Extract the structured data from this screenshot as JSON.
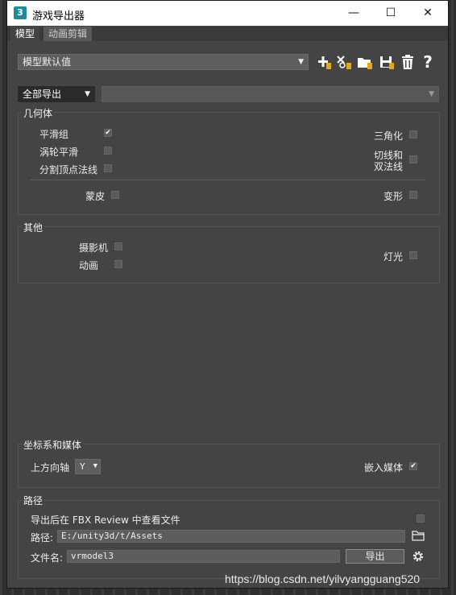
{
  "window": {
    "title": "游戏导出器",
    "app_icon_text": "3",
    "minimize_glyph": "—",
    "maximize_glyph": "☐",
    "close_glyph": "✕"
  },
  "tabs": [
    {
      "label": "模型",
      "active": true
    },
    {
      "label": "动画剪辑",
      "active": false
    }
  ],
  "preset": {
    "selected": "模型默认值"
  },
  "toolbar": {
    "icons": [
      "add-preset-icon",
      "save-as-preset-icon",
      "open-folder-icon",
      "save-icon",
      "trash-icon",
      "help-icon"
    ]
  },
  "export_mode": {
    "selected": "全部导出",
    "secondary_value": ""
  },
  "geometry": {
    "title": "几何体",
    "smoothing_groups": {
      "label": "平滑组",
      "checked": true
    },
    "turbosmooth": {
      "label": "涡轮平滑",
      "checked": false
    },
    "split_normals": {
      "label": "分割顶点法线",
      "checked": false
    },
    "triangulate": {
      "label": "三角化",
      "checked": false
    },
    "tangents_line1": "切线和",
    "tangents_line2": "双法线",
    "tangents_checked": false,
    "skin": {
      "label": "蒙皮",
      "checked": false
    },
    "morph": {
      "label": "变形",
      "checked": false
    }
  },
  "other": {
    "title": "其他",
    "camera": {
      "label": "摄影机",
      "checked": false
    },
    "animation": {
      "label": "动画",
      "checked": false
    },
    "lights": {
      "label": "灯光",
      "checked": false
    }
  },
  "coords": {
    "title": "坐标系和媒体",
    "up_axis_label": "上方向轴",
    "up_axis_value": "Y",
    "embed_media": {
      "label": "嵌入媒体",
      "checked": true
    }
  },
  "path": {
    "title": "路径",
    "view_in_review": {
      "label": "导出后在 FBX Review 中查看文件",
      "checked": false
    },
    "path_label": "路径:",
    "path_value": "E:/unity3d/t/Assets",
    "filename_label": "文件名:",
    "filename_value": "vrmodel3",
    "export_button": "导出"
  },
  "watermark": "https://blog.csdn.net/yilvyangguang520",
  "colors": {
    "panel": "#444444",
    "accent_badge": "#e6a817"
  }
}
